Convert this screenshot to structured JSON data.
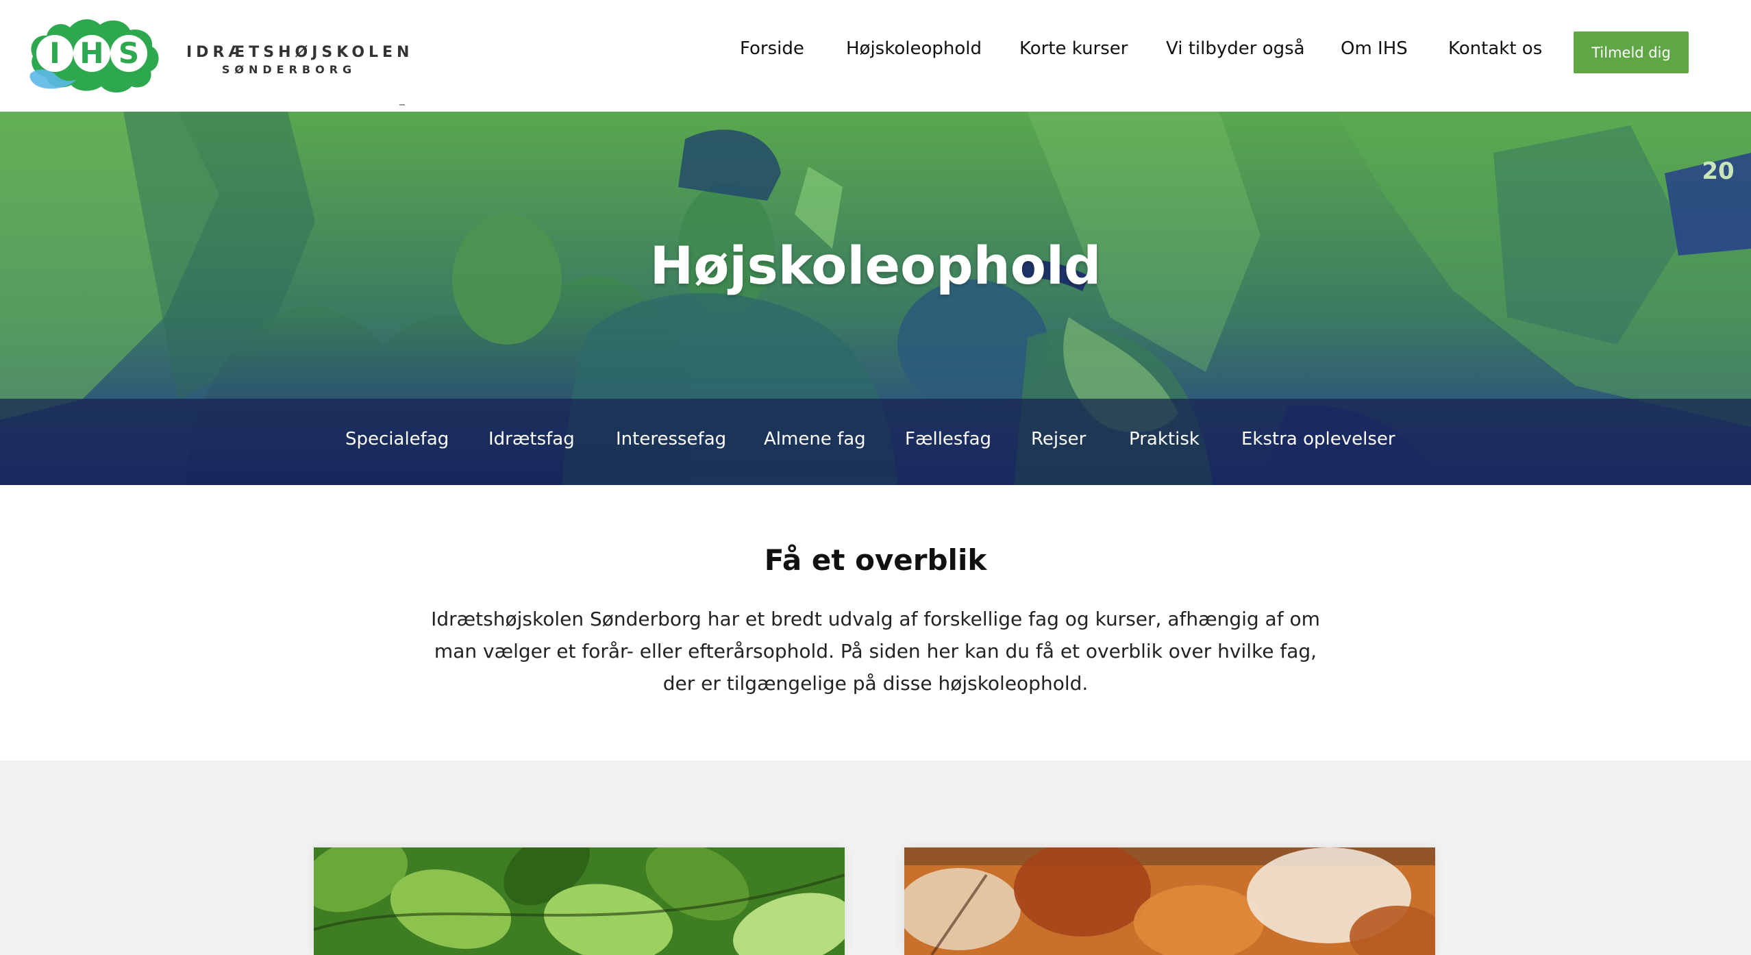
{
  "header": {
    "logo_text": "IHS",
    "brand_line1": "IDRÆTSHØJSKOLEN",
    "brand_line2": "SØNDERBORG",
    "nav": [
      {
        "label": "Forside"
      },
      {
        "label": "Højskoleophold"
      },
      {
        "label": "Korte kurser"
      },
      {
        "label": "Vi tilbyder også"
      },
      {
        "label": "Om IHS"
      },
      {
        "label": "Kontakt os"
      }
    ],
    "signup_label": "Tilmeld dig"
  },
  "hero": {
    "title": "Højskoleophold",
    "image_text": "20",
    "subnav": [
      {
        "label": "Specialefag"
      },
      {
        "label": "Idrætsfag"
      },
      {
        "label": "Interessefag"
      },
      {
        "label": "Almene fag"
      },
      {
        "label": "Fællesfag"
      },
      {
        "label": "Rejser"
      },
      {
        "label": "Praktisk"
      },
      {
        "label": "Ekstra oplevelser"
      }
    ]
  },
  "intro": {
    "heading": "Få et overblik",
    "text": "Idrætshøjskolen Sønderborg har et bredt udvalg af forskellige fag og kurser, afhængig af om man vælger et forår- eller efterårsophold. På siden her kan du få et overblik over hvilke fag, der er tilgængelige på disse højskoleophold."
  },
  "colors": {
    "brand_green": "#5fa744",
    "hero_green": "#4a9a4c",
    "hero_blue": "#24378f",
    "subnav_overlay": "#162250",
    "cards_background": "#f2f2f2"
  },
  "icons": {
    "logo": "ihs-leaf-logo"
  }
}
